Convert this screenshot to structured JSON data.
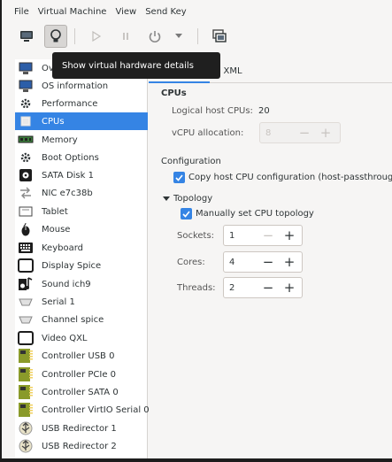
{
  "menubar": {
    "items": [
      "File",
      "Virtual Machine",
      "View",
      "Send Key"
    ]
  },
  "toolbar": {
    "tooltip": "Show virtual hardware details"
  },
  "tabs": {
    "details_partial": "s",
    "xml": "XML"
  },
  "sidebar": {
    "items": [
      {
        "label": "Ov",
        "icon": "overview-icon"
      },
      {
        "label": "OS information",
        "icon": "os-information-icon"
      },
      {
        "label": "Performance",
        "icon": "performance-icon"
      },
      {
        "label": "CPUs",
        "icon": "cpu-icon"
      },
      {
        "label": "Memory",
        "icon": "memory-icon"
      },
      {
        "label": "Boot Options",
        "icon": "boot-options-icon"
      },
      {
        "label": "SATA Disk 1",
        "icon": "disk-icon"
      },
      {
        "label": "NIC e7c38b",
        "icon": "network-icon"
      },
      {
        "label": "Tablet",
        "icon": "tablet-icon"
      },
      {
        "label": "Mouse",
        "icon": "mouse-icon"
      },
      {
        "label": "Keyboard",
        "icon": "keyboard-icon"
      },
      {
        "label": "Display Spice",
        "icon": "display-icon"
      },
      {
        "label": "Sound ich9",
        "icon": "sound-icon"
      },
      {
        "label": "Serial 1",
        "icon": "serial-icon"
      },
      {
        "label": "Channel spice",
        "icon": "channel-icon"
      },
      {
        "label": "Video QXL",
        "icon": "video-icon"
      },
      {
        "label": "Controller USB 0",
        "icon": "controller-icon"
      },
      {
        "label": "Controller PCIe 0",
        "icon": "controller-icon"
      },
      {
        "label": "Controller SATA 0",
        "icon": "controller-icon"
      },
      {
        "label": "Controller VirtIO Serial 0",
        "icon": "controller-icon"
      },
      {
        "label": "USB Redirector 1",
        "icon": "usb-redirector-icon"
      },
      {
        "label": "USB Redirector 2",
        "icon": "usb-redirector-icon"
      }
    ],
    "selected_index": 3
  },
  "cpus": {
    "section_title": "CPUs",
    "logical_host_label": "Logical host CPUs:",
    "logical_host_value": "20",
    "vcpu_label": "vCPU allocation:",
    "vcpu_value": "8"
  },
  "configuration": {
    "title": "Configuration",
    "copy_host_label": "Copy host CPU configuration (host-passthrough)",
    "copy_host_checked": true
  },
  "topology": {
    "title": "Topology",
    "manual_label": "Manually set CPU topology",
    "manual_checked": true,
    "sockets_label": "Sockets:",
    "sockets_value": "1",
    "cores_label": "Cores:",
    "cores_value": "4",
    "threads_label": "Threads:",
    "threads_value": "2"
  },
  "colors": {
    "accent": "#3584e4",
    "tooltip_bg": "#1f1f1f"
  }
}
